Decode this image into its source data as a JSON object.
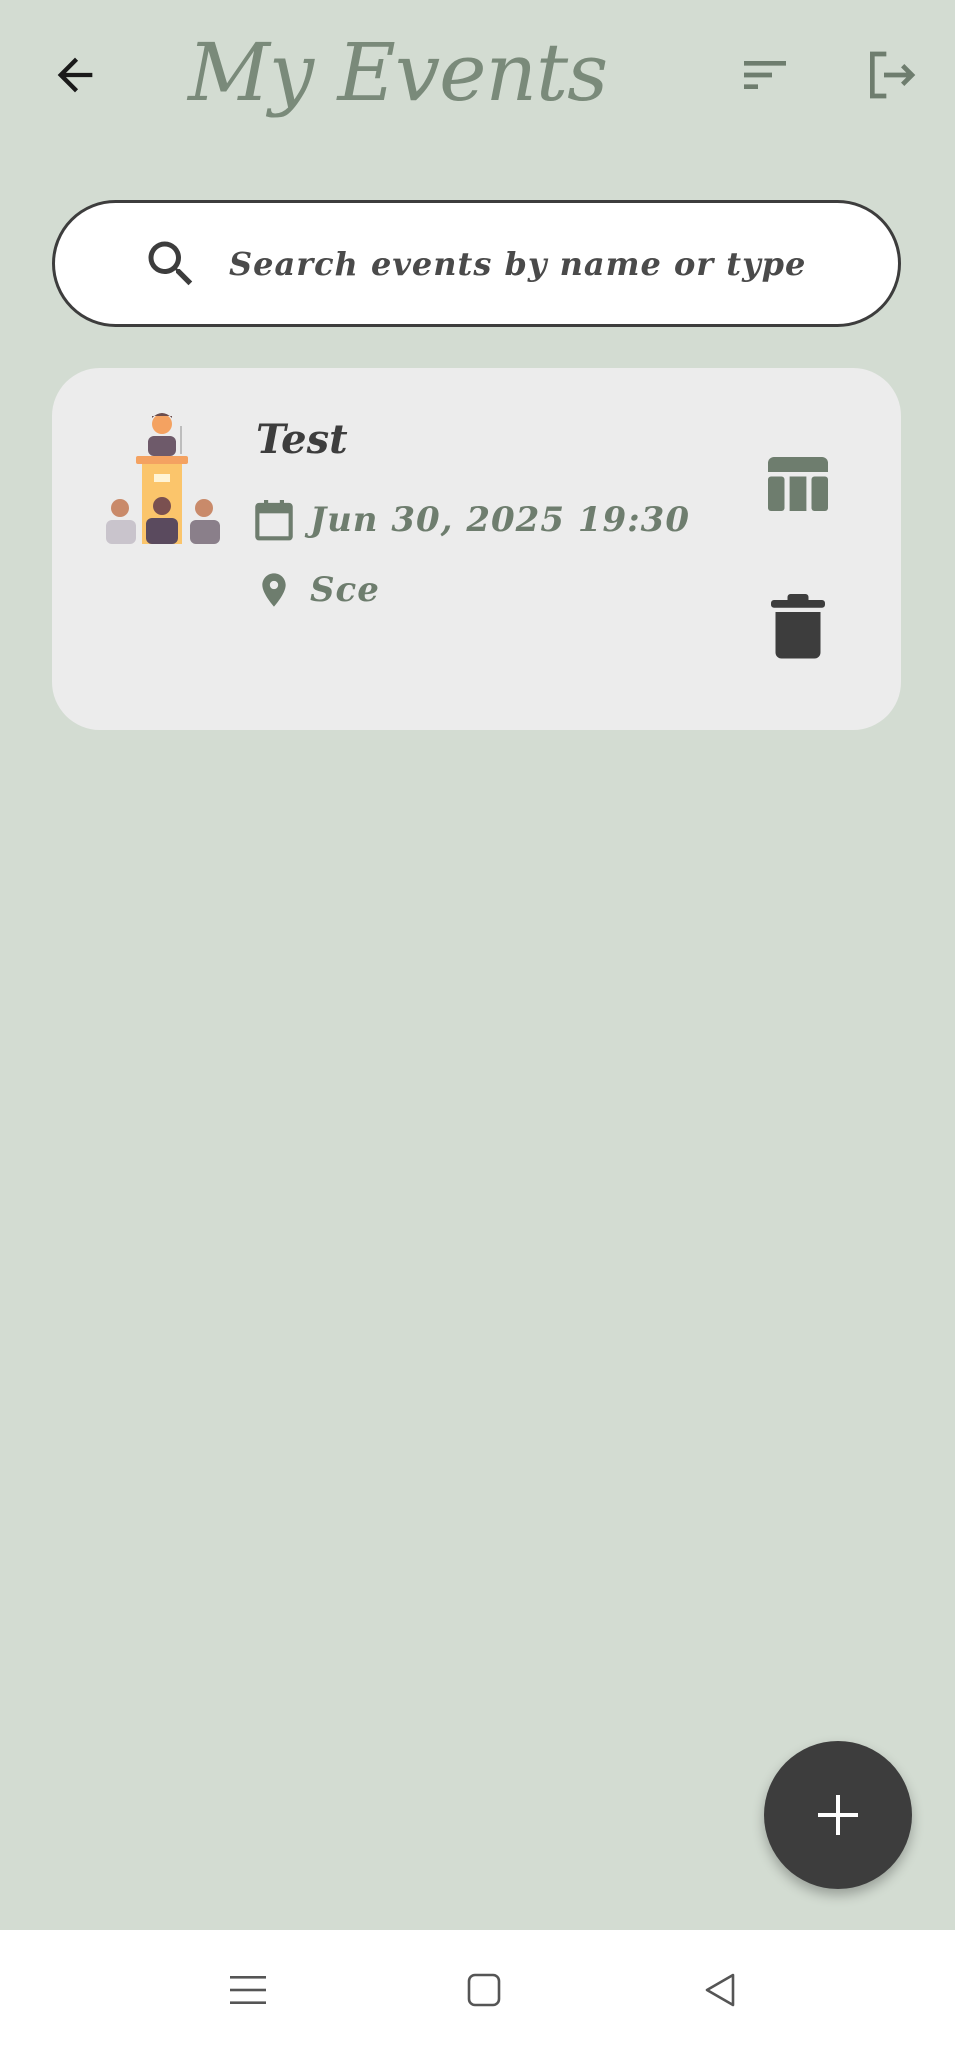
{
  "header": {
    "title": "My Events",
    "back_icon": "arrow-left-icon",
    "sort_icon": "sort-icon",
    "logout_icon": "logout-icon"
  },
  "search": {
    "placeholder": "Search events by name or type",
    "icon": "search-icon"
  },
  "events": [
    {
      "title": "Test",
      "datetime": "Jun 30, 2025 19:30",
      "location": "Sce",
      "illustration": "conference-speaker-icon",
      "actions": [
        "table-icon",
        "trash-icon"
      ]
    }
  ],
  "fab": {
    "icon": "plus-icon"
  },
  "system_nav": {
    "items": [
      "recents-icon",
      "home-icon",
      "back-triangle-icon"
    ]
  },
  "colors": {
    "background": "#d3dcd2",
    "accent": "#7a8a7a",
    "dark": "#3d3d3d",
    "card": "#ececec"
  }
}
